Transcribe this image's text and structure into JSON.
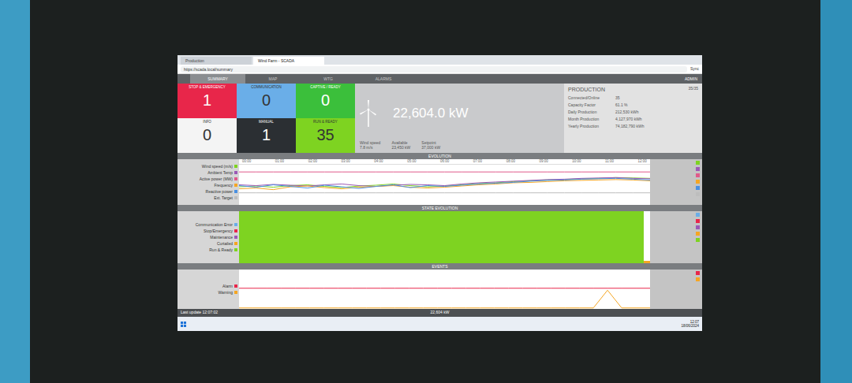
{
  "browser": {
    "tabs": [
      {
        "label": "Production",
        "selected": false
      },
      {
        "label": "Wind Farm - SCADA",
        "selected": true
      }
    ],
    "address": "https://scada.local/summary",
    "account": "Sync"
  },
  "app": {
    "tabs": [
      {
        "label": "SUMMARY",
        "selected": true
      },
      {
        "label": "MAP",
        "selected": false
      },
      {
        "label": "WTG",
        "selected": false
      },
      {
        "label": "ALARMS",
        "selected": false
      }
    ],
    "user": "ADMIN"
  },
  "status_tiles": [
    {
      "label": "STOP & EMERGENCY",
      "value": "1",
      "color": "#e8264a"
    },
    {
      "label": "COMMUNICATION",
      "value": "0",
      "color": "#6aaee8"
    },
    {
      "label": "CAPTIVE / READY",
      "value": "0",
      "color": "#3bbf3b"
    },
    {
      "label": "INFO",
      "value": "0",
      "color": "#f4f4f4"
    },
    {
      "label": "MANUAL",
      "value": "1",
      "color": "#2b2f33"
    },
    {
      "label": "RUN & READY",
      "value": "35",
      "color": "#7ed321"
    }
  ],
  "power": {
    "value": "22,604.0 kW",
    "stats": [
      {
        "label": "Wind speed",
        "value": "7.8 m/s"
      },
      {
        "label": "Available",
        "value": "23,450 kW"
      },
      {
        "label": "Setpoint",
        "value": "37,000 kW"
      }
    ]
  },
  "production": {
    "title": "PRODUCTION",
    "badge": "35/35",
    "rows": [
      {
        "label": "Connected/Online",
        "value": "35"
      },
      {
        "label": "Capacity Factor",
        "value": "61.1 %"
      },
      {
        "label": "Daily Production",
        "value": "212,530 kWh"
      },
      {
        "label": "Month Production",
        "value": "4,127,970 kWh"
      },
      {
        "label": "Yearly Production",
        "value": "74,182,790 kWh"
      }
    ]
  },
  "evolution": {
    "title": "EVOLUTION",
    "max": 100,
    "ticks": [
      "00:00",
      "01:00",
      "02:00",
      "03:00",
      "04:00",
      "05:00",
      "06:00",
      "07:00",
      "08:00",
      "09:00",
      "10:00",
      "11:00",
      "12:00"
    ],
    "series": [
      {
        "name": "Wind speed (m/s)",
        "color": "#7ed321",
        "values": [
          45,
          47,
          44,
          48,
          50,
          46,
          43,
          47,
          49,
          52,
          48,
          45,
          47,
          50,
          53,
          55,
          58,
          60,
          62,
          63,
          65,
          66,
          68,
          67,
          66
        ]
      },
      {
        "name": "Ambient Temp",
        "color": "#9b59b6",
        "values": [
          50,
          48,
          51,
          49,
          47,
          50,
          52,
          48,
          46,
          49,
          51,
          50,
          48,
          52,
          55,
          57,
          59,
          61,
          63,
          64,
          66,
          67,
          68,
          66,
          65
        ]
      },
      {
        "name": "Active power (MW)",
        "color": "#e05a8a",
        "values": [
          82,
          82,
          82,
          82,
          82,
          82,
          82,
          82,
          82,
          82,
          82,
          82,
          82,
          82,
          82,
          82,
          82,
          82,
          82,
          82,
          82,
          82,
          82,
          82,
          82
        ]
      },
      {
        "name": "Frequency",
        "color": "#f5a623",
        "values": [
          40,
          42,
          38,
          45,
          47,
          43,
          40,
          44,
          46,
          48,
          44,
          42,
          44,
          47,
          50,
          52,
          55,
          56,
          58,
          60,
          61,
          62,
          63,
          62,
          60
        ]
      },
      {
        "name": "Reactive power",
        "color": "#4a90e2",
        "values": [
          48,
          44,
          50,
          46,
          42,
          49,
          45,
          41,
          46,
          50,
          43,
          48,
          46,
          49,
          52,
          54,
          56,
          59,
          61,
          62,
          64,
          65,
          66,
          64,
          62
        ]
      },
      {
        "name": "Ext. Target",
        "color": "#bdbdbd",
        "values": [
          30,
          30,
          30,
          30,
          30,
          30,
          30,
          30,
          30,
          30,
          30,
          30,
          30,
          30,
          30,
          30,
          30,
          30,
          30,
          30,
          30,
          30,
          30,
          30,
          30
        ]
      }
    ]
  },
  "state_evolution": {
    "title": "STATE EVOLUTION",
    "legend": [
      {
        "name": "Communication Error",
        "color": "#6aaee8"
      },
      {
        "name": "Stop/Emergency",
        "color": "#e8264a"
      },
      {
        "name": "Maintenance",
        "color": "#9b59b6"
      },
      {
        "name": "Curtailed",
        "color": "#f5a623"
      },
      {
        "name": "Run & Ready",
        "color": "#7ed321"
      }
    ],
    "bands": [
      {
        "color": "#7ed321",
        "level": 0.985
      },
      {
        "color": "#f5a623",
        "level": 0.015
      }
    ]
  },
  "events": {
    "title": "EVENTS",
    "max": 1,
    "series": [
      {
        "name": "Alarm",
        "color": "#e8264a",
        "values": [
          0,
          0,
          0,
          0,
          0,
          0,
          0,
          0,
          0,
          0,
          0,
          0,
          0,
          0,
          0,
          0,
          0,
          0,
          0,
          0,
          0,
          0,
          0,
          0,
          0,
          0,
          0,
          0,
          0,
          0
        ]
      },
      {
        "name": "Warning",
        "color": "#f5a623",
        "values": [
          0,
          0,
          0,
          0,
          0,
          0,
          0,
          0,
          0,
          0,
          0,
          0,
          0,
          0,
          0,
          0,
          0,
          0,
          0,
          0,
          0,
          0,
          0,
          0,
          0,
          0,
          1,
          0,
          0,
          0
        ]
      }
    ]
  },
  "status_line": {
    "left": "Last update 12:07:02",
    "center": "22,604 kW"
  },
  "taskbar": {
    "time": "12:07",
    "date": "18/06/2024"
  }
}
